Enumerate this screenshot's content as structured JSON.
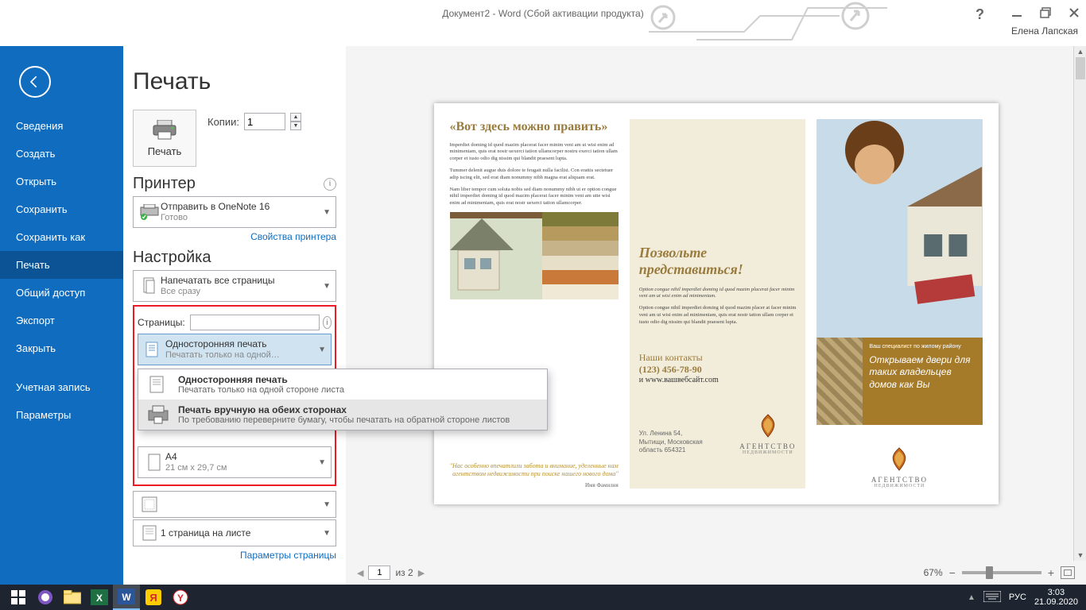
{
  "title": "Документ2 - Word (Сбой активации продукта)",
  "user": "Елена Лапская",
  "nav": {
    "items": [
      "Сведения",
      "Создать",
      "Открыть",
      "Сохранить",
      "Сохранить как",
      "Печать",
      "Общий доступ",
      "Экспорт",
      "Закрыть"
    ],
    "bottom": [
      "Учетная запись",
      "Параметры"
    ],
    "active": "Печать"
  },
  "page_heading": "Печать",
  "print_button_label": "Печать",
  "copies_label": "Копии:",
  "copies_value": "1",
  "printer": {
    "section": "Принтер",
    "name": "Отправить в OneNote 16",
    "status": "Готово",
    "props_link": "Свойства принтера"
  },
  "settings": {
    "section": "Настройка",
    "scope_l1": "Напечатать все страницы",
    "scope_l2": "Все сразу",
    "pages_label": "Страницы:",
    "pages_value": "",
    "sides_l1": "Односторонняя печать",
    "sides_l2": "Печатать только на одной…",
    "dropdown": {
      "opt1_l1": "Односторонняя печать",
      "opt1_l2": "Печатать только на одной стороне листа",
      "opt2_l1": "Печать вручную на обеих сторонах",
      "opt2_l2": "По требованию переверните бумагу, чтобы печатать на обратной стороне листов"
    },
    "paper_l1": "A4",
    "paper_l2": "21 см x 29,7 см",
    "persheet": "1 страница на листе",
    "page_params": "Параметры страницы"
  },
  "preview_foot": {
    "page_value": "1",
    "page_of": "из 2",
    "zoom": "67%"
  },
  "doc": {
    "p1_title": "«Вот здесь можно править»",
    "p1_para1": "Imperdiet doming id quod mazim placerat facer minim veni am ut wisi enim ad minimeniam, quis erat nostr uexerci tation ullamcorper nostru exerci tation ullam corper et iusto odio dig nissim qui blandit praesent lupta.",
    "p1_para2": "Tummer delenit augue duis dolore te feugait nulla facilisi. Con erattis sectetuer adip iscing elit, sed erat diam nonummy nibh magna erat aliquam erat.",
    "p1_para3": "Nam liber tempor cum soluta nobis sed diam nonummy nibh ut er option congue nihil imperdiet doming id quod mazim placerat facer minim veni am utte wisi enim ad minimeniam, quis erat nostr uexerci tation ullamcorper.",
    "quote": "\"Нас особенно впечатлили забота и внимание, уделенные нам агентством недвижимости при поиске нашего нового дома\"",
    "quote_name": "Имя Фамилия",
    "p2_title": "Позвольте представиться!",
    "p2_para1": "Option congue nihil imperdiet doming id quod mazim placerat facer minim veni am ut wisi enim ad minimeniam.",
    "p2_para2": "Option congue nihil imperdiet doming id quod mazim placer at facer minim veni am ut wisi enim ad minimeniam, quis erat nostr tation ullam corper et iusto odio dig nissim qui blandit praesent lupta.",
    "contacts_h": "Наши контакты",
    "phone": "(123) 456-78-90",
    "site": "и www.вашвебсайт.com",
    "addr_l1": "Ул. Ленина 54,",
    "addr_l2": "Мытищи, Московская",
    "addr_l3": "область 654321",
    "agency_l1": "АГЕНТСТВО",
    "agency_l2": "НЕДВИЖИМОСТИ",
    "brand_sm": "Ваш специалист по жилому району",
    "brand_lg": "Открываем двери для таких владельцев домов как Вы"
  },
  "taskbar": {
    "ime": "РУС",
    "time": "3:03",
    "date": "21.09.2020"
  }
}
